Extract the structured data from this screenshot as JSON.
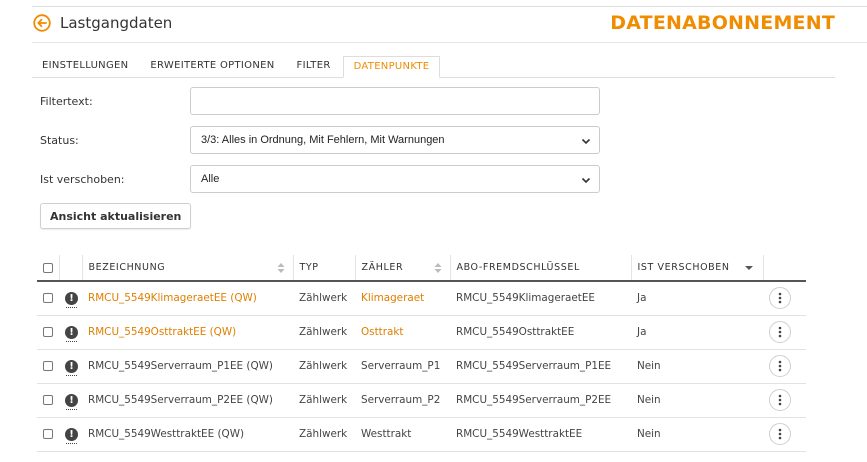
{
  "header": {
    "back_icon": "arrow-left-circle-icon",
    "title": "Lastgangdaten",
    "brand": "DATENABONNEMENT",
    "accent_color": "#f08c00"
  },
  "tabs": [
    {
      "label": "EINSTELLUNGEN",
      "active": false
    },
    {
      "label": "ERWEITERTE OPTIONEN",
      "active": false
    },
    {
      "label": "FILTER",
      "active": false
    },
    {
      "label": "DATENPUNKTE",
      "active": true
    }
  ],
  "form": {
    "filtertext": {
      "label": "Filtertext:",
      "value": "",
      "placeholder": ""
    },
    "status": {
      "label": "Status:",
      "value": "3/3: Alles in Ordnung, Mit Fehlern, Mit Warnungen"
    },
    "verschoben": {
      "label": "Ist verschoben:",
      "value": "Alle"
    },
    "refresh_button": "Ansicht aktualisieren"
  },
  "table": {
    "columns": [
      "BEZEICHNUNG",
      "TYP",
      "ZÄHLER",
      "ABO-FREMDSCHLÜSSEL",
      "IST VERSCHOBEN"
    ],
    "rows": [
      {
        "name": "RMCU_5549KlimageraetEE (QW)",
        "typ": "Zählwerk",
        "zaehler": "Klimageraet",
        "key": "RMCU_5549KlimageraetEE",
        "verschoben": "Ja",
        "highlight": true
      },
      {
        "name": "RMCU_5549OsttraktEE (QW)",
        "typ": "Zählwerk",
        "zaehler": "Osttrakt",
        "key": "RMCU_5549OsttraktEE",
        "verschoben": "Ja",
        "highlight": true
      },
      {
        "name": "RMCU_5549Serverraum_P1EE (QW)",
        "typ": "Zählwerk",
        "zaehler": "Serverraum_P1",
        "key": "RMCU_5549Serverraum_P1EE",
        "verschoben": "Nein",
        "highlight": false
      },
      {
        "name": "RMCU_5549Serverraum_P2EE (QW)",
        "typ": "Zählwerk",
        "zaehler": "Serverraum_P2",
        "key": "RMCU_5549Serverraum_P2EE",
        "verschoben": "Nein",
        "highlight": false
      },
      {
        "name": "RMCU_5549WesttraktEE (QW)",
        "typ": "Zählwerk",
        "zaehler": "Westtrakt",
        "key": "RMCU_5549WesttraktEE",
        "verschoben": "Nein",
        "highlight": false
      }
    ]
  }
}
